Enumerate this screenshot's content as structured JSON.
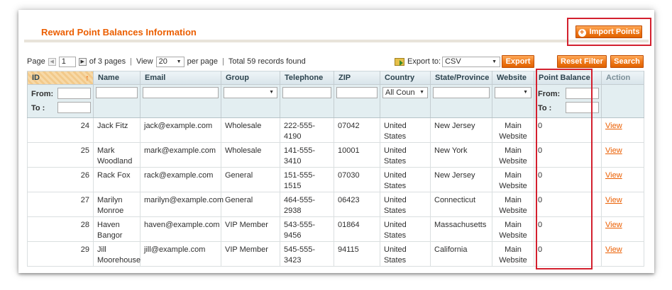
{
  "page": {
    "title": "Reward Point Balances Information",
    "import_label": "Import Points"
  },
  "pager": {
    "page_label": "Page",
    "page_value": "1",
    "of_pages": "of 3 pages",
    "view_label": "View",
    "view_value": "20",
    "per_page": "per page",
    "total": "Total 59 records found"
  },
  "export": {
    "label": "Export to:",
    "format": "CSV",
    "button": "Export"
  },
  "actions": {
    "reset": "Reset Filter",
    "search": "Search"
  },
  "columns": [
    "ID",
    "Name",
    "Email",
    "Group",
    "Telephone",
    "ZIP",
    "Country",
    "State/Province",
    "Website",
    "Point Balance",
    "Action"
  ],
  "filters": {
    "from": "From:",
    "to": "To :",
    "country_value": "All Coun"
  },
  "rows": [
    {
      "id": "24",
      "name": "Jack Fitz",
      "email": "jack@example.com",
      "group": "Wholesale",
      "phone": "222-555-4190",
      "zip": "07042",
      "country": "United States",
      "state": "New Jersey",
      "website": "Main Website",
      "points": "0",
      "action": "View"
    },
    {
      "id": "25",
      "name": "Mark Woodland",
      "email": "mark@example.com",
      "group": "Wholesale",
      "phone": "141-555-3410",
      "zip": "10001",
      "country": "United States",
      "state": "New York",
      "website": "Main Website",
      "points": "0",
      "action": "View"
    },
    {
      "id": "26",
      "name": "Rack Fox",
      "email": "rack@example.com",
      "group": "General",
      "phone": "151-555-1515",
      "zip": "07030",
      "country": "United States",
      "state": "New Jersey",
      "website": "Main Website",
      "points": "0",
      "action": "View"
    },
    {
      "id": "27",
      "name": "Marilyn Monroe",
      "email": "marilyn@example.com",
      "group": "General",
      "phone": "464-555-2938",
      "zip": "06423",
      "country": "United States",
      "state": "Connecticut",
      "website": "Main Website",
      "points": "0",
      "action": "View"
    },
    {
      "id": "28",
      "name": "Haven Bangor",
      "email": "haven@example.com",
      "group": "VIP Member",
      "phone": "543-555-9456",
      "zip": "01864",
      "country": "United States",
      "state": "Massachusetts",
      "website": "Main Website",
      "points": "0",
      "action": "View"
    },
    {
      "id": "29",
      "name": "Jill Moorehouse",
      "email": "jill@example.com",
      "group": "VIP Member",
      "phone": "545-555-3423",
      "zip": "94115",
      "country": "United States",
      "state": "California",
      "website": "Main Website",
      "points": "0",
      "action": "View"
    }
  ],
  "colors": {
    "accent": "#eb5e00",
    "highlight": "#d3202e",
    "header_bg": "#d8e4ea",
    "filter_bg": "#e3eef1"
  },
  "icons": {
    "import": "plus-circle-icon",
    "export": "spreadsheet-icon",
    "sort": "sort-arrow-up-icon"
  }
}
